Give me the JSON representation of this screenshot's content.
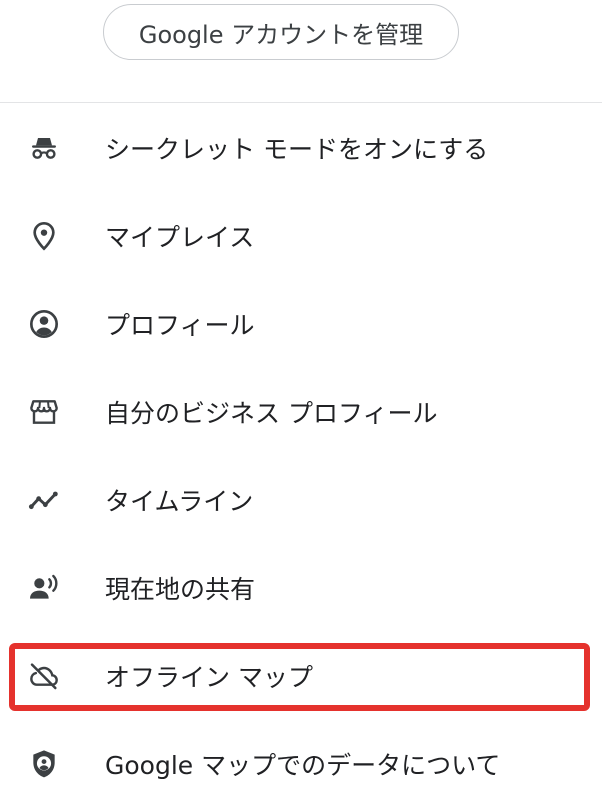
{
  "account": {
    "manage_button_label": "Google アカウントを管理"
  },
  "menu": {
    "items": [
      {
        "label": "シークレット モードをオンにする",
        "icon": "incognito-icon"
      },
      {
        "label": "マイプレイス",
        "icon": "location-pin-icon"
      },
      {
        "label": "プロフィール",
        "icon": "account-circle-icon"
      },
      {
        "label": "自分のビジネス プロフィール",
        "icon": "storefront-icon"
      },
      {
        "label": "タイムライン",
        "icon": "timeline-icon"
      },
      {
        "label": "現在地の共有",
        "icon": "location-sharing-icon"
      },
      {
        "label": "オフライン マップ",
        "icon": "cloud-off-icon"
      },
      {
        "label": "Google マップでのデータについて",
        "icon": "shield-account-icon"
      }
    ]
  },
  "colors": {
    "highlight": "#e5322d",
    "icon": "#3c4043",
    "text": "#202124",
    "border": "#c9ccd0"
  }
}
